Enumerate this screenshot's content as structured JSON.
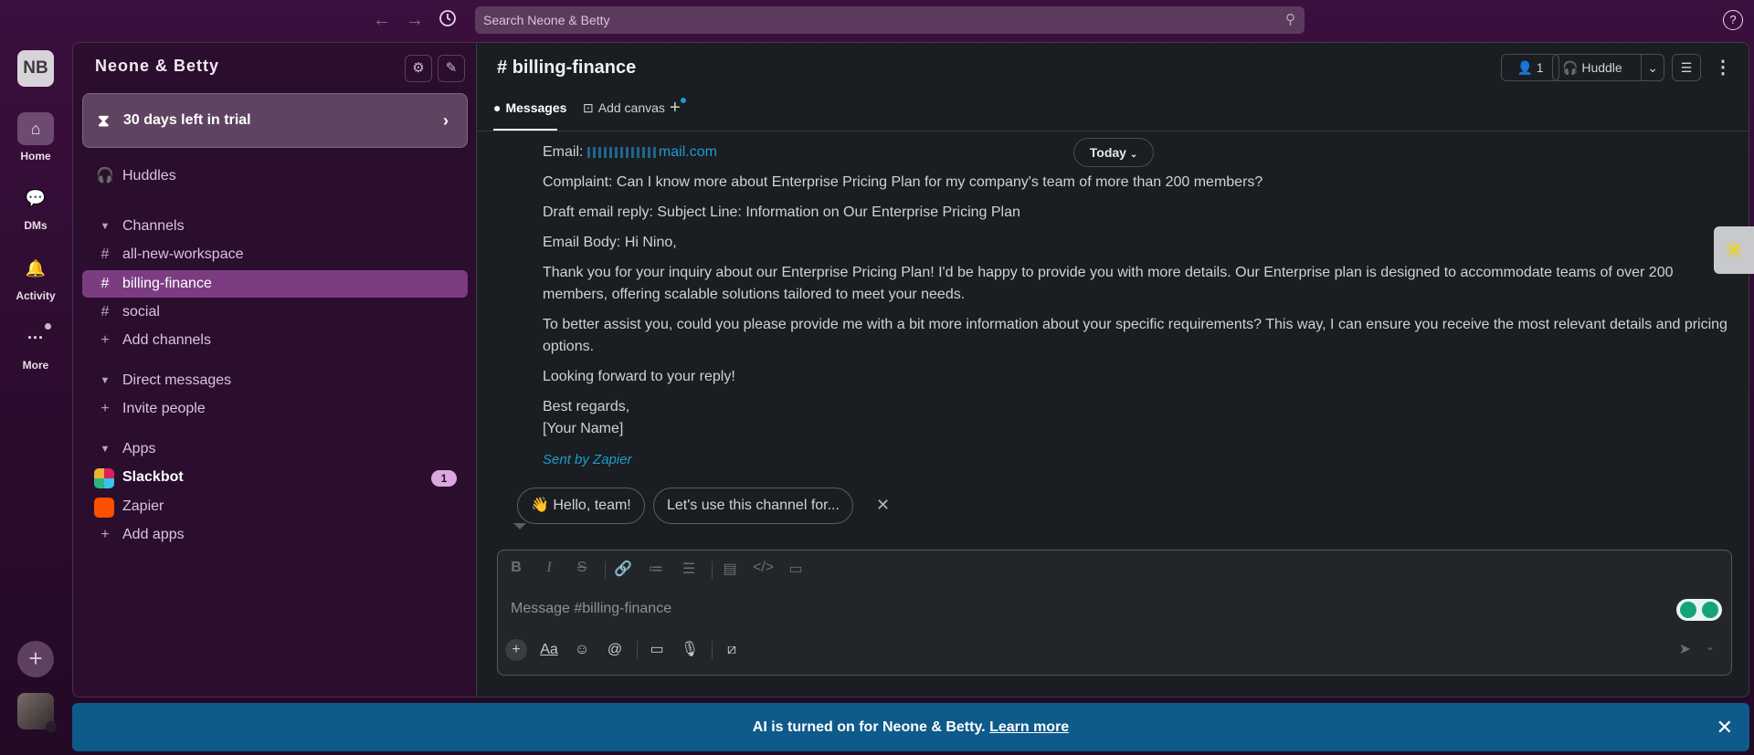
{
  "search": {
    "placeholder": "Search Neone & Betty"
  },
  "rail": {
    "workspace_initials": "NB",
    "items": [
      {
        "label": "Home",
        "icon": "home-icon"
      },
      {
        "label": "DMs",
        "icon": "dms-icon"
      },
      {
        "label": "Activity",
        "icon": "bell-icon"
      },
      {
        "label": "More",
        "icon": "more-icon"
      }
    ]
  },
  "sidebar": {
    "workspace_name": "Neone & Betty",
    "trial_label": "30 days left in trial",
    "huddles_label": "Huddles",
    "channels_header": "Channels",
    "channels": [
      "all-new-workspace",
      "billing-finance",
      "social"
    ],
    "add_channels": "Add channels",
    "dm_header": "Direct messages",
    "invite_people": "Invite people",
    "apps_header": "Apps",
    "apps": [
      {
        "name": "Slackbot",
        "badge": "1"
      },
      {
        "name": "Zapier"
      }
    ],
    "add_apps": "Add apps"
  },
  "channel": {
    "title": "billing-finance",
    "member_count": "1",
    "huddle_label": "Huddle",
    "tabs": {
      "messages": "Messages",
      "add_canvas": "Add canvas"
    }
  },
  "messages": {
    "today_label": "Today",
    "email_label": "Email:",
    "email_value": "mail.com",
    "complaint": "Complaint: Can I know more about Enterprise Pricing Plan for my company's team of more than 200 members?",
    "draft_subject": "Draft email reply: Subject Line: Information on Our Enterprise Pricing Plan",
    "email_body": "Email Body: Hi Nino,",
    "para1": "Thank you for your inquiry about our Enterprise Pricing Plan! I'd be happy to provide you with more details. Our Enterprise plan is designed to accommodate teams of over 200 members, offering scalable solutions tailored to meet your needs.",
    "para2": "To better assist you, could you please provide me with a bit more information about your specific requirements? This way, I can ensure you receive the most relevant details and pricing options.",
    "closing": "Looking forward to your reply!",
    "regards": "Best regards,",
    "name": "[Your Name]",
    "sent_by": "Sent by Zapier"
  },
  "suggestions": [
    "👋 Hello, team!",
    "Let's use this channel for..."
  ],
  "composer": {
    "placeholder": "Message #billing-finance"
  },
  "banner": {
    "text": "AI is turned on for Neone & Betty.",
    "link": "Learn more"
  },
  "colors": {
    "sidebar_active": "#7b3c82",
    "link": "#1d9bd1",
    "banner": "#0e5a8a"
  }
}
